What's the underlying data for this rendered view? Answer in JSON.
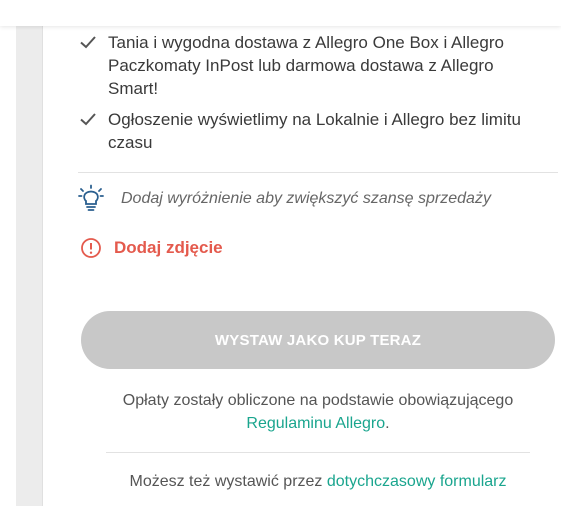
{
  "features": [
    "Tania i wygodna dostawa z Allegro One Box i Allegro Paczkomaty InPost lub darmowa dostawa z Allegro Smart!",
    "Ogłoszenie wyświetlimy na Lokalnie i Allegro bez limitu czasu"
  ],
  "hint": {
    "text": "Dodaj wyróżnienie aby zwiększyć szansę sprzedaży",
    "icon": "lightbulb-icon"
  },
  "warning": {
    "text": "Dodaj zdjęcie",
    "icon": "info-circle-icon",
    "color": "#e45a4d"
  },
  "submit": {
    "label": "WYSTAW JAKO KUP TERAZ"
  },
  "fees": {
    "text": "Opłaty zostały obliczone na podstawie obowiązującego",
    "link": "Regulaminu Allegro",
    "suffix": "."
  },
  "alternative": {
    "text": "Możesz też wystawić przez",
    "link": "dotychczasowy formularz"
  },
  "colors": {
    "accent": "#1aa58e",
    "icon_blue": "#2a5f8f",
    "disabled_button": "#c8c8c8"
  }
}
